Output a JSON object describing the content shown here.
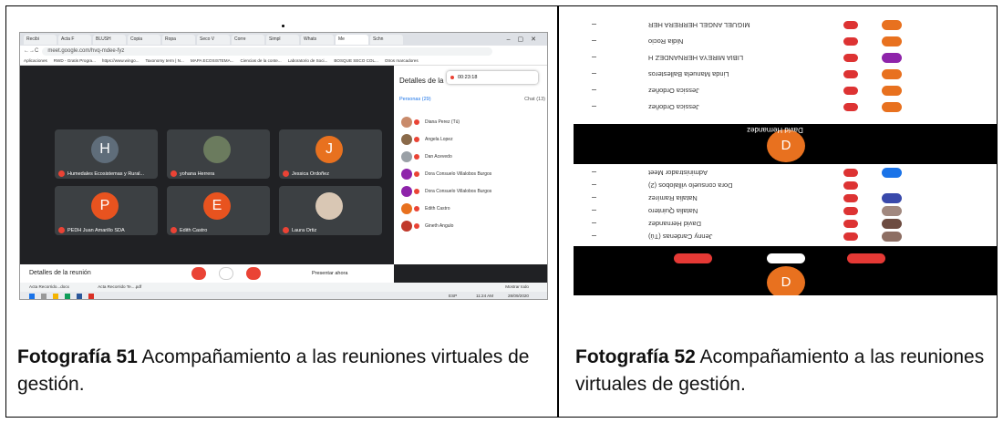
{
  "left_photo": {
    "caption_bold": "Fotografía 51",
    "caption_text": " Acompañamiento a las reuniones virtuales de gestión.",
    "browser": {
      "tabs": [
        "Recibi",
        "Acta F",
        "BLUSH",
        "Copia",
        "Ropa",
        "Seco V",
        "Corre",
        "Simpl",
        "Whats",
        "Me",
        "Schn"
      ],
      "url": "meet.google.com/hvq-mdee-fyz",
      "bookmarks": [
        "Aplicaciones",
        "RWD - Gratis Progra...",
        "https://www.wingo...",
        "Taxonomy term | N...",
        "MAPA ECOSISTEMA...",
        "Ciencias de la conte...",
        "Laboratorio de Soci...",
        "BOSQUE SECO COL...",
        "Otros marcadores"
      ]
    },
    "meeting": {
      "participants_tiles": [
        {
          "initial": "H",
          "name": "Humedales Ecosistemas y Rural...",
          "color": "#5f6d7a"
        },
        {
          "initial": "",
          "name": "yohana Herrera",
          "color": "#6b7b5e"
        },
        {
          "initial": "J",
          "name": "Jessica Ordoñez",
          "color": "#e8711f"
        },
        {
          "initial": "P",
          "name": "PEDH Juan Amarillo SDA",
          "color": "#e8531f"
        },
        {
          "initial": "E",
          "name": "Edith Castro",
          "color": "#e8531f"
        },
        {
          "initial": "",
          "name": "Laura Ortiz",
          "color": "#d9c7b4"
        }
      ],
      "panel_title": "Detalles de la",
      "recording_time": "00:23:18",
      "people_tab": "Personas (29)",
      "chat_tab": "Chat (13)",
      "people": [
        {
          "name": "Diana Perez (Tú)",
          "color": "#c98b6b"
        },
        {
          "name": "Angela Lopez",
          "color": "#8a6a4a"
        },
        {
          "name": "Dan Acevedo",
          "color": "#9aa0a6"
        },
        {
          "name": "Dora Consuelo Villalobos Burgos",
          "color": "#8e24aa"
        },
        {
          "name": "Dora Consuelo Villalobos Burgos",
          "color": "#8e24aa"
        },
        {
          "name": "Edith Castro",
          "color": "#e8711f"
        },
        {
          "name": "Gineth Angulo",
          "color": "#c0392b"
        }
      ],
      "details_label": "Detalles de la reunión",
      "present_label": "Presentar ahora",
      "downloads": [
        "Acta Recorrido...docx",
        "Acta Recorrido Te....pdf"
      ],
      "show_all": "Mostrar todo",
      "clock": "11:24 AM",
      "date": "28/09/2020",
      "lang": "ESP"
    }
  },
  "right_photo": {
    "caption_bold": "Fotografía 52",
    "caption_text": " Acompañamiento a las reuniones virtuales de gestión.",
    "top_rows": [
      {
        "text": "MIGUEL ANGEL HERRERA HER",
        "color": "#e8711f"
      },
      {
        "text": "Nidia Rocio",
        "color": "#e8711f"
      },
      {
        "text": "LIBIA MIREYA HERNANDEZ H",
        "color": "#8e24aa"
      },
      {
        "text": "Linda Manuela Ballesteros",
        "color": "#e8711f"
      },
      {
        "text": "Jessica Ordoñez",
        "color": "#e8711f"
      },
      {
        "text": "Jessica Ordoñez",
        "color": "#e8711f"
      }
    ],
    "big_initial": "D",
    "big_name": "David Hernandez",
    "mid_rows": [
      {
        "text": "Administrador Meet",
        "color": "#1a73e8"
      },
      {
        "text": "Dora consuelo villalobos (2)",
        "color": "#fff"
      },
      {
        "text": "Natalia Ramírez",
        "color": "#3949ab"
      },
      {
        "text": "Natalia Quintero",
        "color": "#a1887f"
      },
      {
        "text": "David Hernandez",
        "color": "#6d4c41"
      },
      {
        "text": "Jenny Cardenas (Tú)",
        "color": "#8d6e63"
      }
    ]
  }
}
